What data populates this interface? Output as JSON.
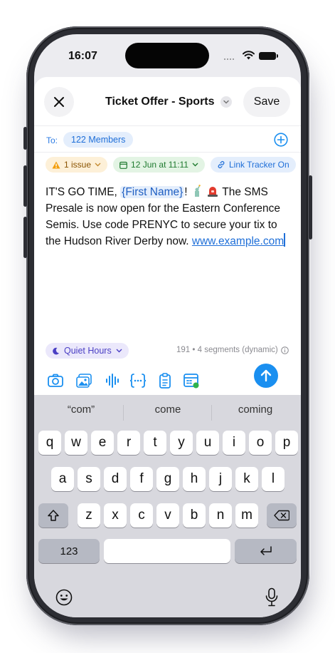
{
  "status_bar": {
    "time": "16:07"
  },
  "header": {
    "title": "Ticket Offer - Sports",
    "save_label": "Save"
  },
  "recipients": {
    "to_label": "To:",
    "members_chip": "122 Members"
  },
  "chips": {
    "issue": "1 issue",
    "schedule": "12 Jun at 11:11",
    "link_tracker": "Link Tracker On"
  },
  "message": {
    "part1": "IT'S GO TIME, ",
    "token": "{First Name}",
    "part2": "! ",
    "part3": " The SMS Presale is now open for the Eastern Conference Semis. Use code PRENYC to secure your tix to the Hudson River Derby now. ",
    "link": "www.example.com"
  },
  "footer": {
    "quiet_hours": "Quiet Hours",
    "segments": "191 • 4 segments (dynamic)"
  },
  "toolbar_icons": [
    "camera-icon",
    "image-icon",
    "audio-waveform-icon",
    "variable-braces-icon",
    "clipboard-icon",
    "card-calendar-icon"
  ],
  "keyboard": {
    "suggestions": [
      "“com”",
      "come",
      "coming"
    ],
    "row1": [
      "q",
      "w",
      "e",
      "r",
      "t",
      "y",
      "u",
      "i",
      "o",
      "p"
    ],
    "row2": [
      "a",
      "s",
      "d",
      "f",
      "g",
      "h",
      "j",
      "k",
      "l"
    ],
    "row3": [
      "z",
      "x",
      "c",
      "v",
      "b",
      "n",
      "m"
    ],
    "numbers_key": "123"
  },
  "colors": {
    "accent_blue": "#1a8ff0",
    "issue_orange": "#f29d0b",
    "schedule_green": "#1f7a2f",
    "quiet_purple": "#4a3fc4"
  }
}
